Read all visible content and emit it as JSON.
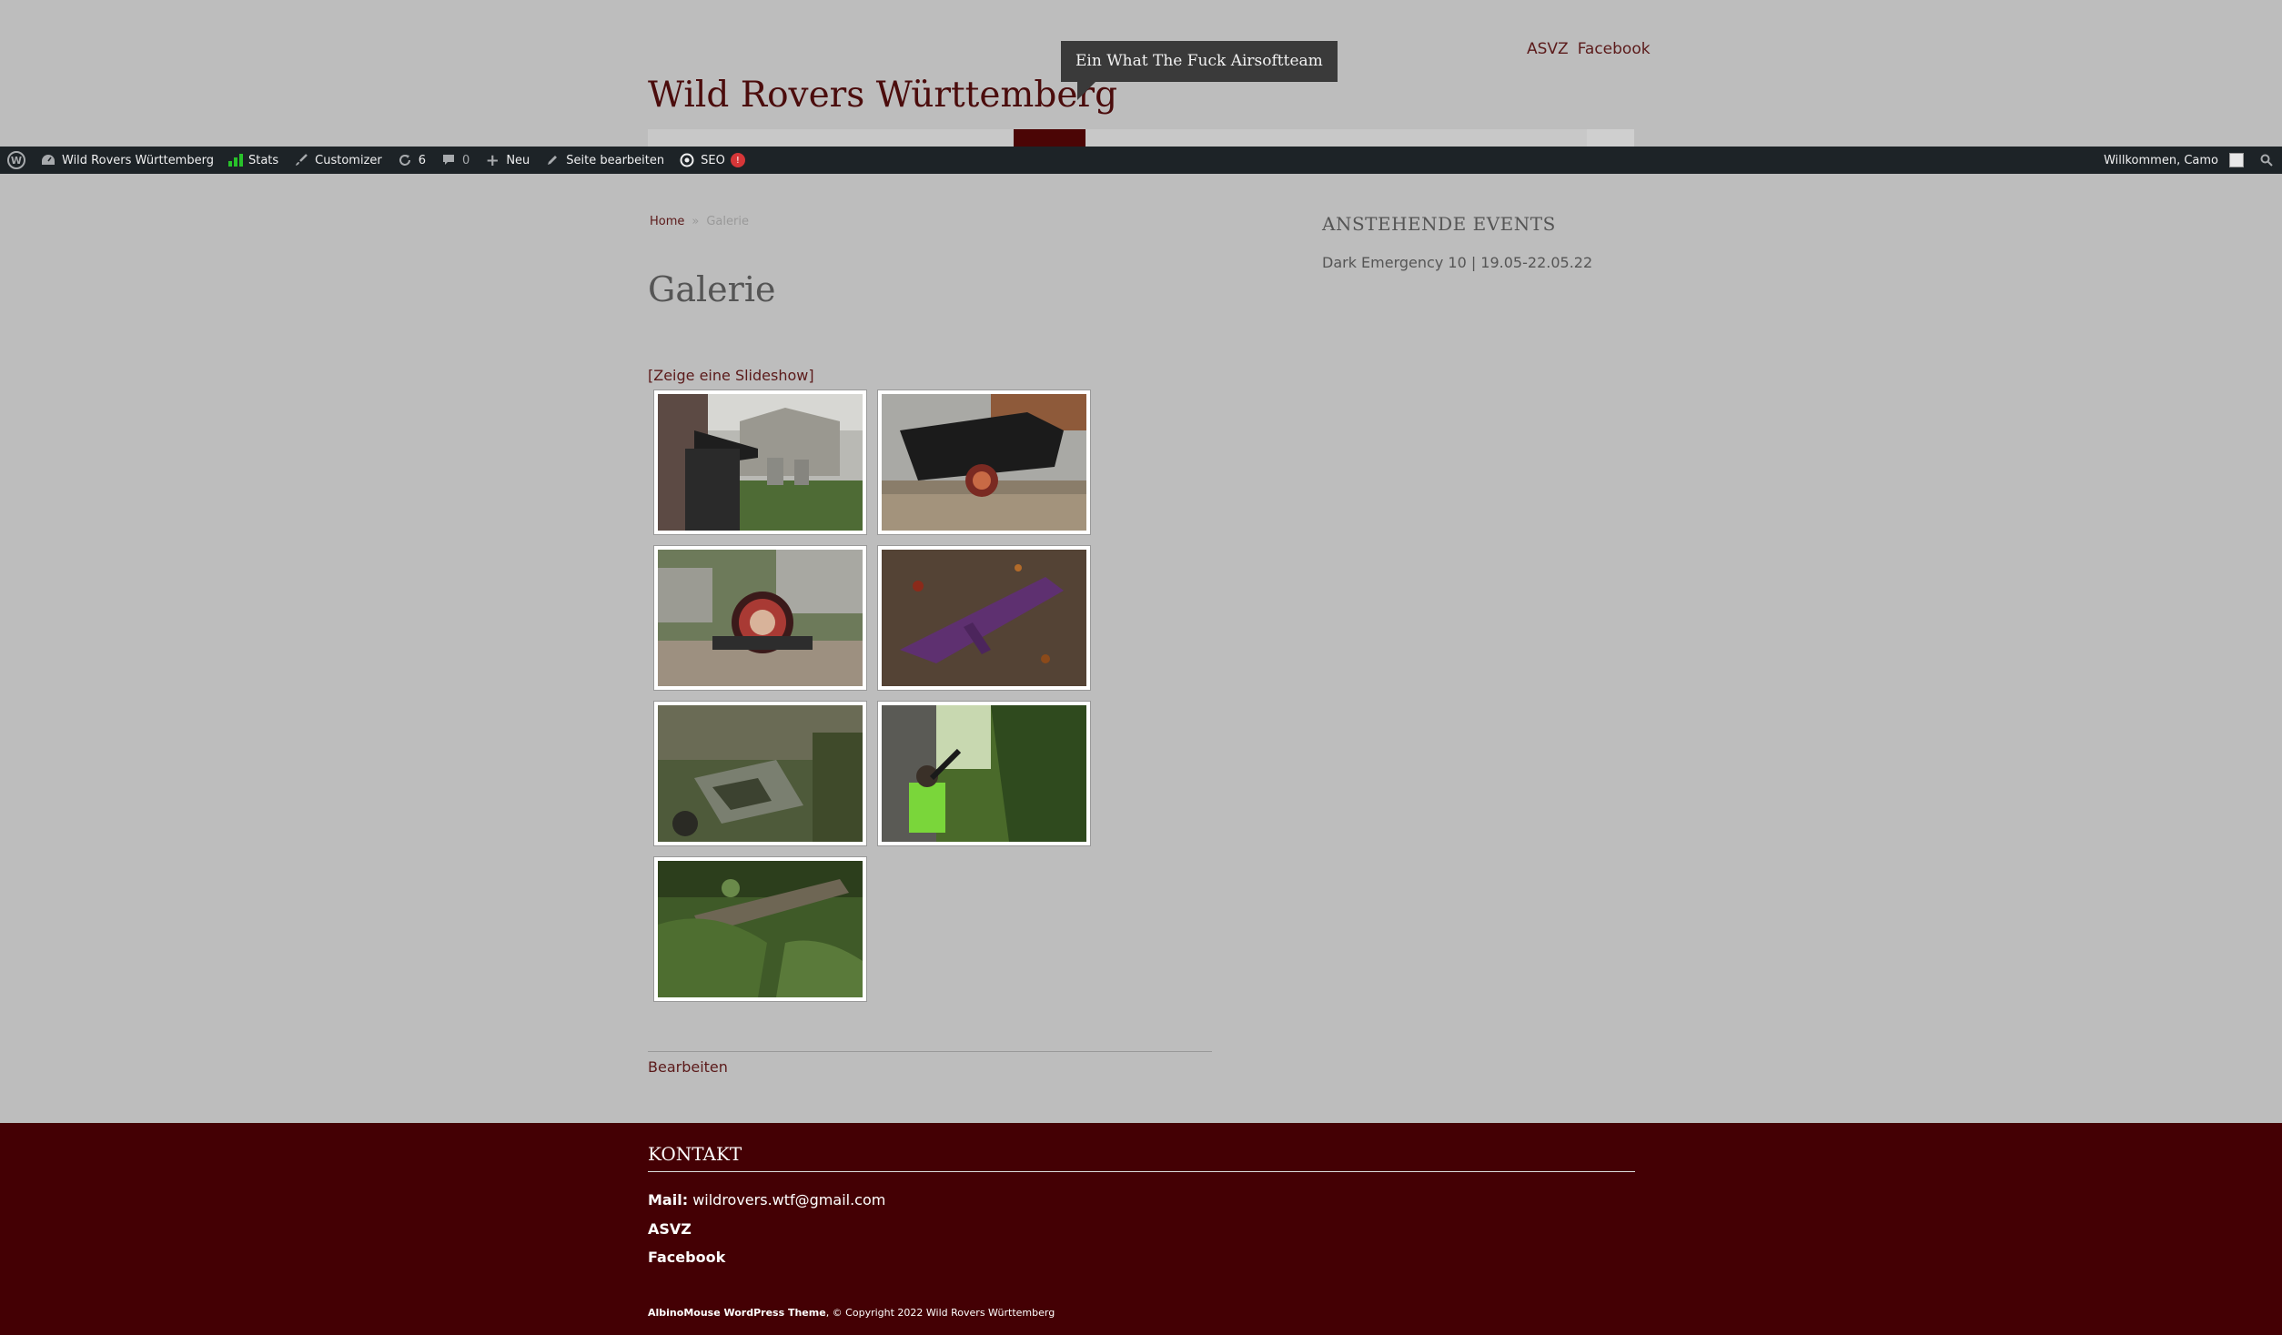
{
  "header": {
    "links": [
      "ASVZ",
      "Facebook"
    ],
    "site_title": "Wild Rovers Württemberg",
    "tagline": "Ein What The Fuck Airsoftteam"
  },
  "adminbar": {
    "site_name": "Wild Rovers Württemberg",
    "stats": "Stats",
    "customizer": "Customizer",
    "updates_count": "6",
    "comments_count": "0",
    "new_label": "Neu",
    "edit_page": "Seite bearbeiten",
    "seo": "SEO",
    "seo_badge": "!",
    "welcome": "Willkommen, Camo"
  },
  "breadcrumb": {
    "home": "Home",
    "separator": "»",
    "current": "Galerie"
  },
  "main": {
    "title": "Galerie",
    "slideshow_link": "[Zeige eine Slideshow]",
    "edit_link": "Bearbeiten",
    "gallery": [
      {
        "icon": "photo-rifle-scope-graveyard"
      },
      {
        "icon": "photo-rifle-patch-wood"
      },
      {
        "icon": "photo-patch-on-wood"
      },
      {
        "icon": "photo-rifle-on-leaves"
      },
      {
        "icon": "photo-forest-bunker"
      },
      {
        "icon": "photo-player-aiming-path"
      },
      {
        "icon": "photo-fallen-tree-forest"
      }
    ]
  },
  "sidebar": {
    "widget_title": "ANSTEHENDE EVENTS",
    "events": [
      "Dark Emergency 10 | 19.05-22.05.22"
    ]
  },
  "footer": {
    "title": "KONTAKT",
    "mail_label": "Mail:",
    "mail_value": "wildrovers.wtf@gmail.com",
    "asvz": "ASVZ",
    "facebook": "Facebook",
    "theme_name": "AlbinoMouse WordPress Theme",
    "copyright": ", © Copyright 2022 Wild Rovers Württemberg"
  },
  "colors": {
    "brand": "#4b0c0c",
    "footer_bg": "#440004",
    "page_bg": "#bdbdbd",
    "adminbar_bg": "#1d2327"
  }
}
